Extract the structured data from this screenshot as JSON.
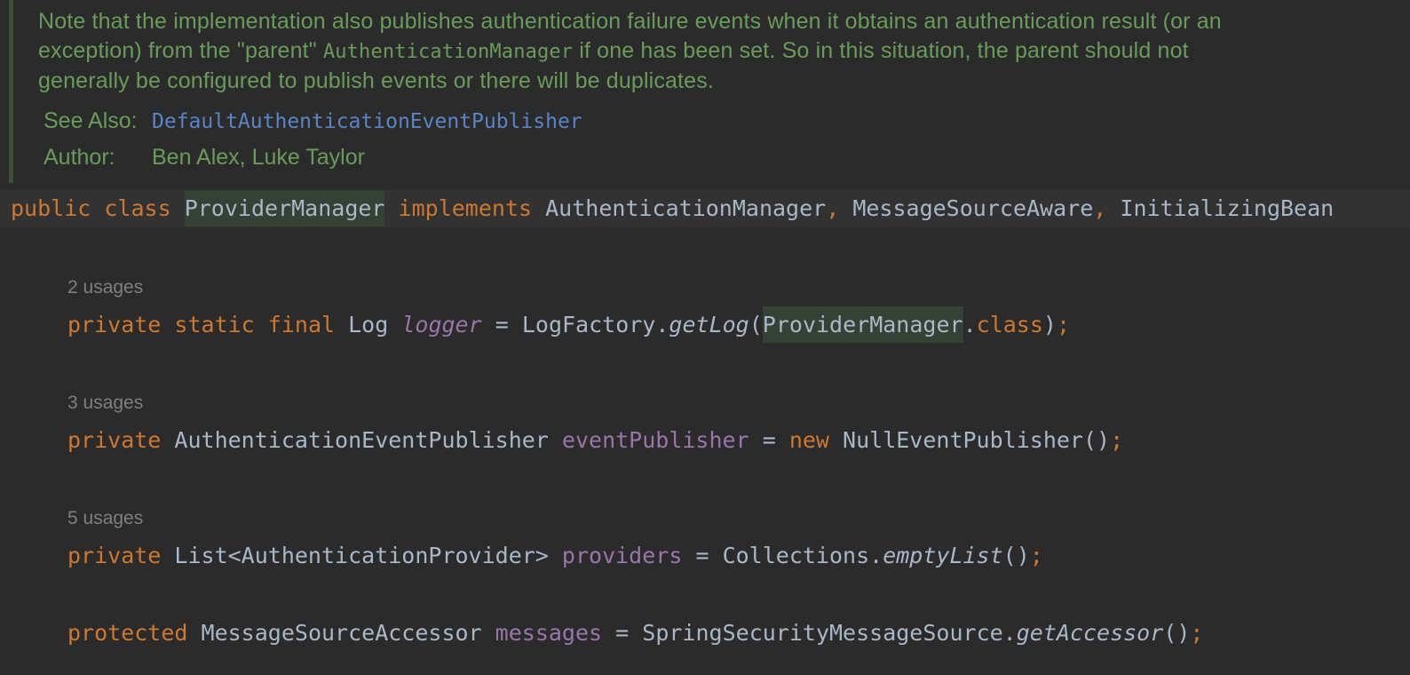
{
  "javadoc": {
    "para_part1": "Note that the implementation also publishes authentication failure events when it obtains an authentication result (or an exception) from the \"parent\" ",
    "para_code": "AuthenticationManager",
    "para_part2": " if one has been set. So in this situation, the parent should not generally be configured to publish events or there will be duplicates.",
    "see_also_label": "See Also:",
    "see_also_link": "DefaultAuthenticationEventPublisher",
    "author_label": "Author:",
    "author_value": "Ben Alex, Luke Taylor"
  },
  "class_decl": {
    "public": "public",
    "class": "class",
    "name": "ProviderManager",
    "implements": "implements",
    "iface1": "AuthenticationManager",
    "iface2": "MessageSourceAware",
    "iface3": "InitializingBean",
    "comma": ","
  },
  "fields": [
    {
      "usages": "2 usages",
      "modifiers": [
        "private",
        "static",
        "final"
      ],
      "type": "Log",
      "name": "logger",
      "init_obj": "LogFactory.",
      "init_method": "getLog",
      "init_open": "(",
      "init_arg": "ProviderManager",
      "init_arg_suffix": ".",
      "init_arg_kw": "class",
      "init_close": ")",
      "semicolon": ";"
    },
    {
      "usages": "3 usages",
      "modifier": "private",
      "type": "AuthenticationEventPublisher",
      "name": "eventPublisher",
      "new_kw": "new",
      "ctor": "NullEventPublisher()",
      "semicolon": ";"
    },
    {
      "usages": "5 usages",
      "modifier": "private",
      "type": "List<AuthenticationProvider>",
      "name": "providers",
      "init_obj": "Collections.",
      "init_method": "emptyList",
      "init_call": "()",
      "semicolon": ";"
    },
    {
      "modifier": "protected",
      "type": "MessageSourceAccessor",
      "name": "messages",
      "init_obj": "SpringSecurityMessageSource.",
      "init_method": "getAccessor",
      "init_call": "()",
      "semicolon": ";"
    }
  ],
  "operators": {
    "assign": "="
  }
}
